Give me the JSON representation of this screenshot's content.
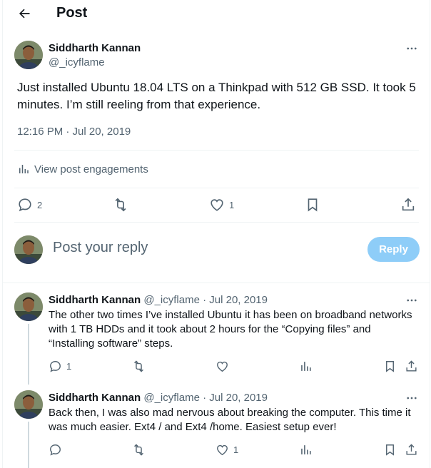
{
  "header": {
    "title": "Post"
  },
  "post": {
    "author_name": "Siddharth Kannan",
    "author_handle": "@_icyflame",
    "text": "Just installed Ubuntu 18.04 LTS on a Thinkpad with 512 GB SSD. It took 5 minutes. I’m still reeling from that experience.",
    "timestamp": "12:16 PM · Jul 20, 2019",
    "engagements_label": "View post engagements",
    "replies_count": "2",
    "likes_count": "1"
  },
  "composer": {
    "placeholder": "Post your reply",
    "reply_label": "Reply"
  },
  "replies": [
    {
      "author_name": "Siddharth Kannan",
      "meta": "@_icyflame · Jul 20, 2019",
      "text": "The other two times I’ve installed Ubuntu it has been on broadband networks with 1 TB HDDs and it took about 2 hours for the “Copying files” and “Installing software” steps.",
      "replies_count": "1",
      "likes_count": ""
    },
    {
      "author_name": "Siddharth Kannan",
      "meta": "@_icyflame · Jul 20, 2019",
      "text": "Back then, I was also mad nervous about breaking the computer. This time it was much easier. Ext4 / and Ext4 /home. Easiest setup ever!",
      "replies_count": "",
      "likes_count": "1"
    }
  ],
  "icons": [
    "back-arrow-icon",
    "more-icon",
    "analytics-icon",
    "reply-icon",
    "retweet-icon",
    "like-icon",
    "bookmark-icon",
    "share-icon"
  ],
  "colors": {
    "text": "#0f1419",
    "muted": "#536471",
    "divider": "#eff3f4",
    "reply_button": "#8ecdf8",
    "thread_line": "#cfd9de"
  }
}
